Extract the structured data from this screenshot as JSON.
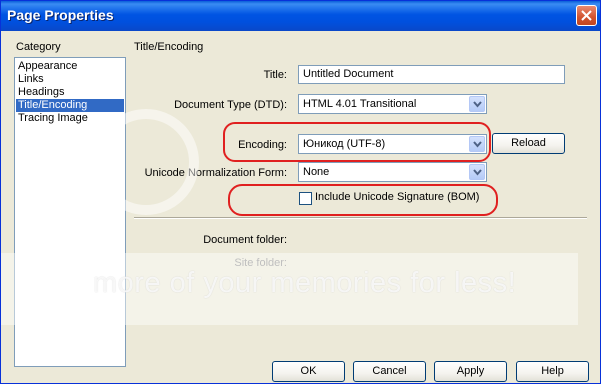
{
  "window": {
    "title": "Page Properties",
    "close_icon": "close-x-icon"
  },
  "category": {
    "label": "Category",
    "items": [
      "Appearance",
      "Links",
      "Headings",
      "Title/Encoding",
      "Tracing Image"
    ],
    "selected": "Title/Encoding"
  },
  "section": {
    "title": "Title/Encoding"
  },
  "form": {
    "title_label": "Title:",
    "title_value": "Untitled Document",
    "doctype_label": "Document Type (DTD):",
    "doctype_value": "HTML 4.01 Transitional",
    "encoding_label": "Encoding:",
    "encoding_value": "Юникод (UTF-8)",
    "reload_label": "Reload",
    "normalization_label": "Unicode Normalization Form:",
    "normalization_value": "None",
    "bom_label": "Include Unicode Signature (BOM)",
    "bom_checked": false,
    "document_folder_label": "Document folder:",
    "site_folder_label": "Site folder:"
  },
  "buttons": {
    "ok": "OK",
    "cancel": "Cancel",
    "apply": "Apply",
    "help": "Help"
  },
  "watermark": {
    "text": "more of your memories for less!"
  },
  "colors": {
    "titlebar": "#0054e3",
    "selection": "#316ac5",
    "highlight_oval": "#e02020",
    "dialog_bg": "#ece9d8"
  }
}
